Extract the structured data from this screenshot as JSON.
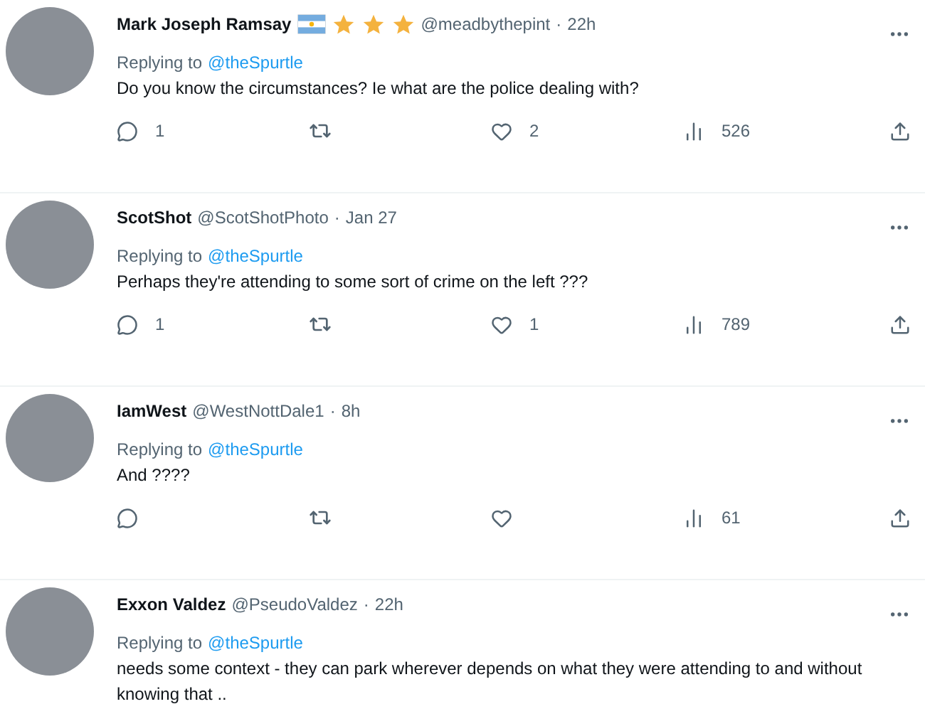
{
  "tweets": [
    {
      "name": "Mark Joseph Ramsay",
      "badges": [
        {
          "kind": "flag"
        },
        {
          "kind": "star"
        },
        {
          "kind": "star"
        },
        {
          "kind": "star"
        }
      ],
      "handle": "@meadbythepint",
      "dot": "·",
      "time": "22h",
      "replying_label": "Replying to",
      "replying_to": "@theSpurtle",
      "text": "Do you know the circumstances? Ie what are the police dealing with?",
      "replies": "1",
      "likes": "2",
      "views": "526"
    },
    {
      "name": "ScotShot",
      "handle": "@ScotShotPhoto",
      "dot": "·",
      "time": "Jan 27",
      "replying_label": "Replying to",
      "replying_to": "@theSpurtle",
      "text": "Perhaps they're attending to some sort of crime on the left ???",
      "replies": "1",
      "likes": "1",
      "views": "789"
    },
    {
      "name": "IamWest",
      "handle": "@WestNottDale1",
      "dot": "·",
      "time": "8h",
      "replying_label": "Replying to",
      "replying_to": "@theSpurtle",
      "text": "And ????",
      "views": "61"
    },
    {
      "name": "Exxon Valdez",
      "handle": "@PseudoValdez",
      "dot": "·",
      "time": "22h",
      "replying_label": "Replying to",
      "replying_to": "@theSpurtle",
      "text": "needs some context - they can park wherever depends on what they were attending to and without knowing that .."
    }
  ]
}
